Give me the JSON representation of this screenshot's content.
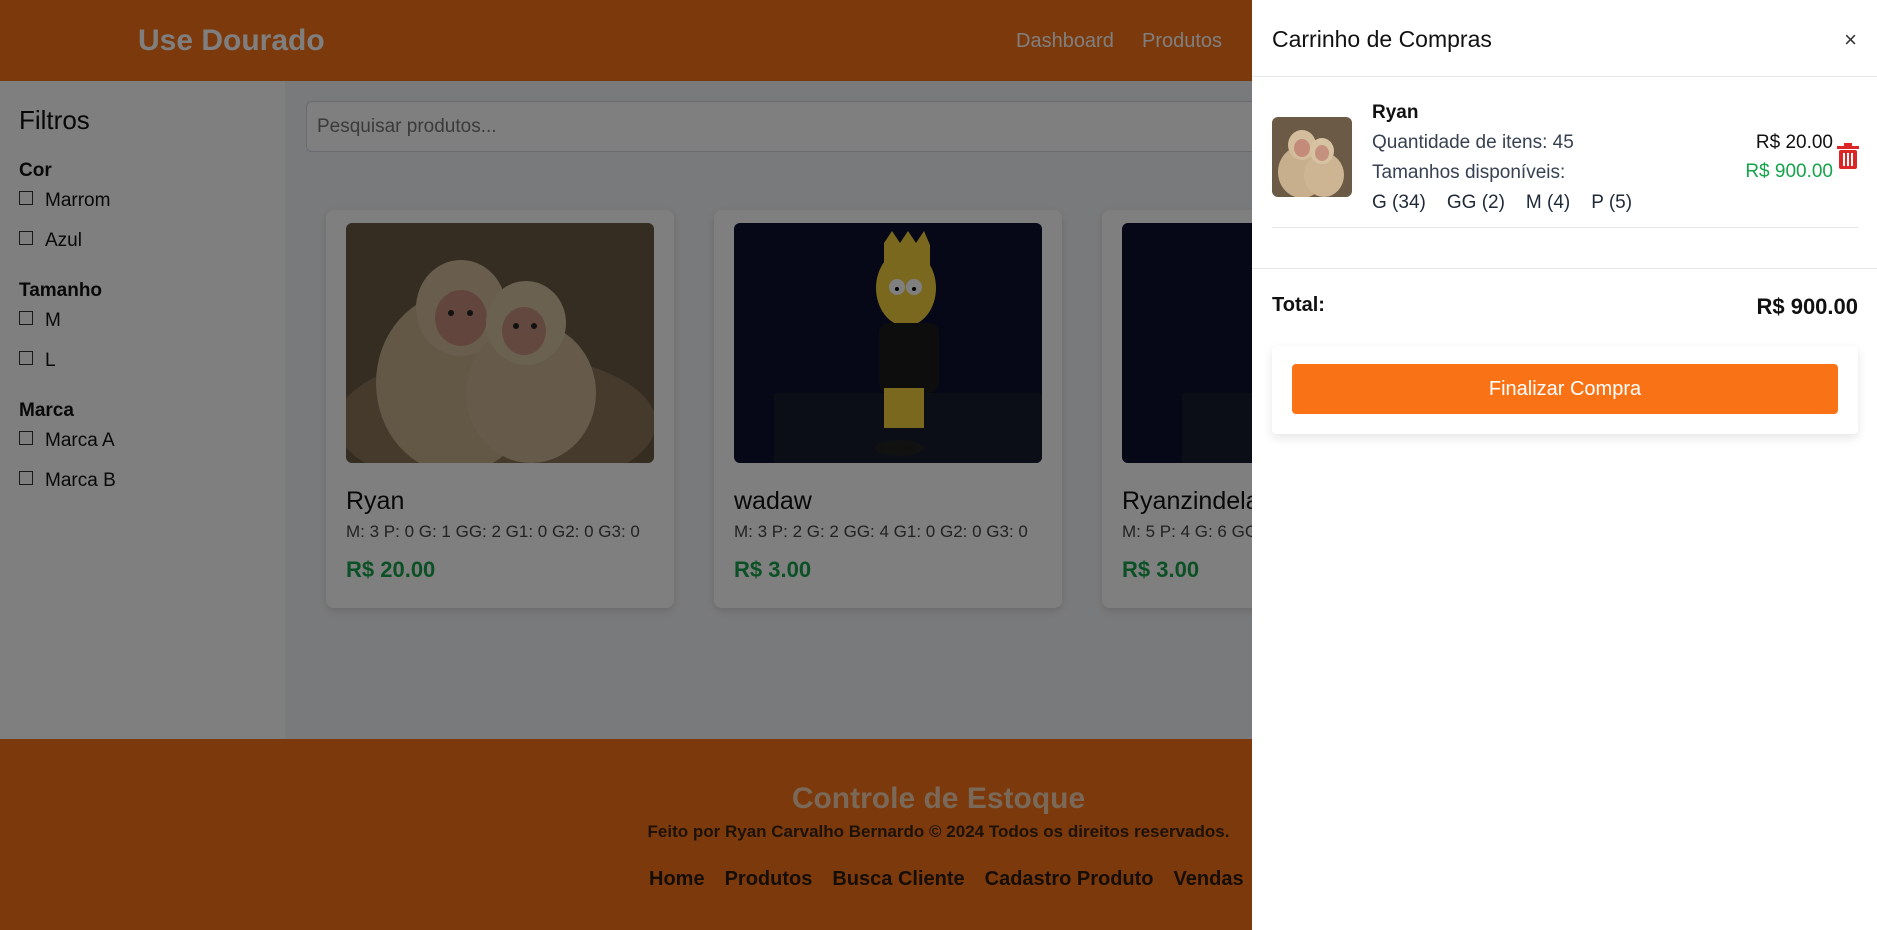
{
  "header": {
    "brand": "Use Dourado",
    "nav": [
      "Dashboard",
      "Produtos"
    ]
  },
  "sidebar": {
    "title": "Filtros",
    "groups": [
      {
        "title": "Cor",
        "options": [
          "Marrom",
          "Azul"
        ]
      },
      {
        "title": "Tamanho",
        "options": [
          "M",
          "L"
        ]
      },
      {
        "title": "Marca",
        "options": [
          "Marca A",
          "Marca B"
        ]
      }
    ]
  },
  "search": {
    "placeholder": "Pesquisar produtos..."
  },
  "products": [
    {
      "name": "Ryan",
      "stock": "M: 3 P: 0 G: 1 GG: 2 G1: 0 G2: 0 G3: 0",
      "price": "R$ 20.00",
      "image": "monkeys-image"
    },
    {
      "name": "wadaw",
      "stock": "M: 3 P: 2 G: 2 GG: 4 G1: 0 G2: 0 G3: 0",
      "price": "R$ 3.00",
      "image": "bart-image"
    },
    {
      "name": "Ryanzindela",
      "stock": "M: 5 P: 4 G: 6 GG",
      "price": "R$ 3.00",
      "image": "bart-image"
    }
  ],
  "footer": {
    "title": "Controle de Estoque",
    "copyright": "Feito por Ryan Carvalho Bernardo © 2024 Todos os direitos reservados.",
    "links": [
      "Home",
      "Produtos",
      "Busca Cliente",
      "Cadastro Produto",
      "Vendas"
    ]
  },
  "cart": {
    "title": "Carrinho de Compras",
    "close": "×",
    "item": {
      "name": "Ryan",
      "quantity": "Quantidade de itens: 45",
      "sizes_label": "Tamanhos disponíveis:",
      "sizes": [
        "G (34)",
        "GG (2)",
        "M (4)",
        "P (5)"
      ],
      "unit_price": "R$ 20.00",
      "subtotal": "R$ 900.00"
    },
    "total_label": "Total:",
    "total_value": "R$ 900.00",
    "checkout": "Finalizar Compra"
  },
  "colors": {
    "accent": "#f97316",
    "price": "#16a34a",
    "delete": "#dc2626"
  }
}
